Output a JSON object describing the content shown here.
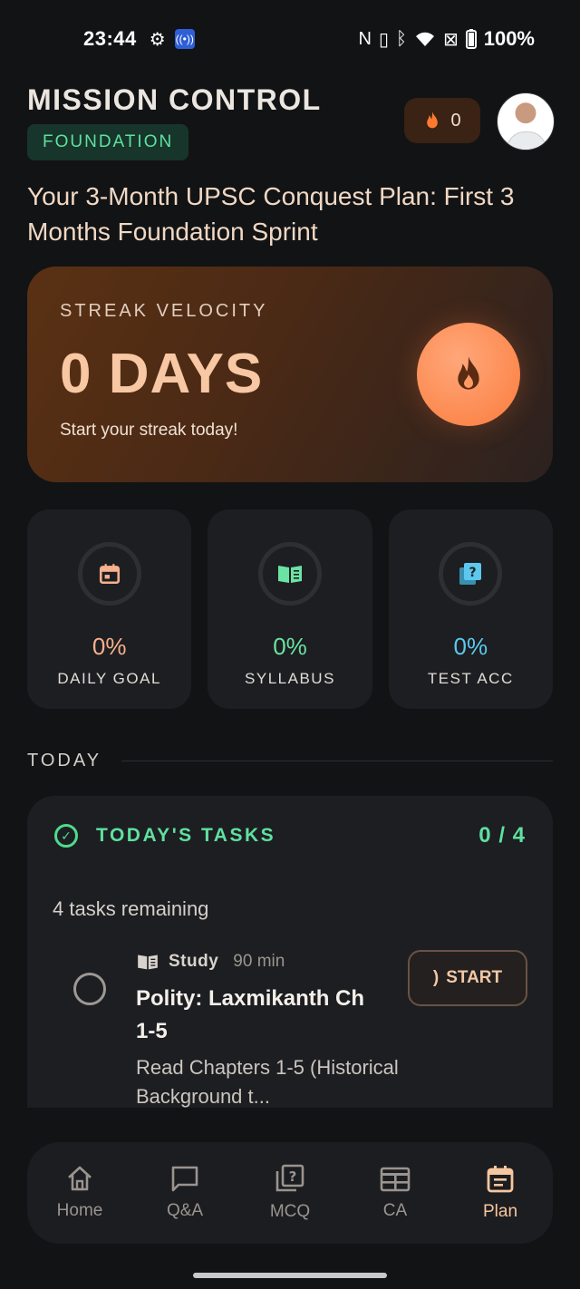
{
  "status_bar": {
    "time": "23:44",
    "battery": "100%"
  },
  "header": {
    "title": "MISSION CONTROL",
    "phase_badge": "FOUNDATION",
    "streak_count": "0",
    "plan_title": "Your 3-Month UPSC Conquest Plan: First 3 Months Foundation Sprint"
  },
  "streak_card": {
    "label": "STREAK VELOCITY",
    "days": "0 DAYS",
    "subtitle": "Start your streak today!"
  },
  "stats": [
    {
      "value": "0%",
      "label": "DAILY GOAL",
      "icon": "calendar-icon",
      "color": "#f7b08e"
    },
    {
      "value": "0%",
      "label": "SYLLABUS",
      "icon": "book-icon",
      "color": "#6be3a4"
    },
    {
      "value": "0%",
      "label": "TEST ACC",
      "icon": "quiz-icon",
      "color": "#5cc8ef"
    }
  ],
  "today_section": {
    "label": "TODAY"
  },
  "tasks": {
    "title": "TODAY'S TASKS",
    "count": "0 / 4",
    "remaining": "4 tasks remaining",
    "items": [
      {
        "type": "Study",
        "duration": "90 min",
        "name": "Polity: Laxmikanth Ch 1-5",
        "description": "Read Chapters 1-5 (Historical Background t...",
        "action": "START"
      }
    ]
  },
  "nav": {
    "items": [
      {
        "label": "Home",
        "icon": "home-icon"
      },
      {
        "label": "Q&A",
        "icon": "chat-icon"
      },
      {
        "label": "MCQ",
        "icon": "quiz-icon"
      },
      {
        "label": "CA",
        "icon": "newspaper-icon"
      },
      {
        "label": "Plan",
        "icon": "calendar-icon"
      }
    ],
    "active": "Plan"
  },
  "colors": {
    "accent": "#f6c6a0",
    "success": "#5fe0a0",
    "background": "#121315",
    "card": "#1d1e21"
  }
}
